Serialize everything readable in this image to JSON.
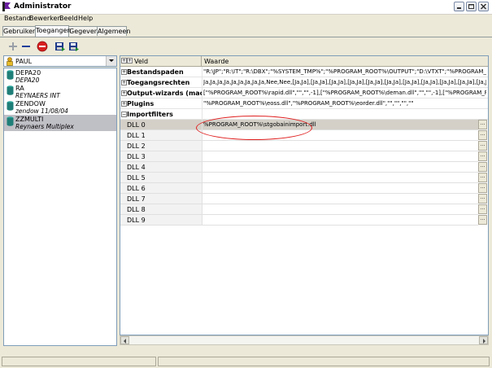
{
  "window": {
    "title": "Administrator"
  },
  "menu": [
    "Bestand",
    "Bewerken",
    "Beeld",
    "Help"
  ],
  "tabs": [
    "Gebruikers",
    "Toegangen",
    "Gegevens",
    "Algemeen"
  ],
  "toolbar": {
    "icons": [
      "add-icon",
      "remove-icon",
      "stop-icon",
      "save-icon",
      "save-as-icon"
    ]
  },
  "user_select": {
    "value": "PAUL"
  },
  "databases": [
    {
      "name": "DEPA20",
      "desc": "DEPA20"
    },
    {
      "name": "RA",
      "desc": "REYNAERS INT"
    },
    {
      "name": "ZENDOW",
      "desc": "zendow 11/08/04"
    },
    {
      "name": "ZZMULTI",
      "desc": "Reynaers Multiplex"
    }
  ],
  "grid": {
    "header": {
      "field": "Veld",
      "value": "Waarde"
    },
    "rows": [
      {
        "name": "Bestandspaden",
        "value": "\"R:\\JP\";\"R:\\IT\";\"R:\\DBX\";\"%SYSTEM_TMP%\";\"%PROGRAM_ROOT%\\OUTPUT\";\"D:\\VTXT\";\"%PROGRAM_ROOT%\\"
      },
      {
        "name": "Toegangsrechten",
        "value": "Ja,Ja,Ja,Ja,Ja,Ja,Ja,Ja,Ja,Nee,Nee,[Ja,Ja],[Ja,Ja],[Ja,Ja],[Ja,Ja],[Ja,Ja],[Ja,Ja],[Ja,Ja],[Ja,Ja],[Ja,Ja],[Ja,Ja],[Ja,Ja],[Ja,Ja],[Ja,Ja]"
      },
      {
        "name": "Output-wizards (machinest",
        "value": "[\"%PROGRAM_ROOT%\\rapid.dll\",\"\",\"\",-1],[\"%PROGRAM_ROOT%\\deman.dll\",\"\",\"\",-1],[\"%PROGRAM_ROOT%\\wegoma"
      },
      {
        "name": "Plugins",
        "value": "\"%PROGRAM_ROOT%\\eoss.dll\",\"%PROGRAM_ROOT%\\eorder.dll\",\"\",\"\",\"\",\"\""
      }
    ],
    "import": {
      "name": "Importfilters",
      "children": [
        {
          "name": "DLL 0",
          "value": "%PROGRAM_ROOT%\\stgobainimport.dll"
        },
        {
          "name": "DLL 1",
          "value": ""
        },
        {
          "name": "DLL 2",
          "value": ""
        },
        {
          "name": "DLL 3",
          "value": ""
        },
        {
          "name": "DLL 4",
          "value": ""
        },
        {
          "name": "DLL 5",
          "value": ""
        },
        {
          "name": "DLL 6",
          "value": ""
        },
        {
          "name": "DLL 7",
          "value": ""
        },
        {
          "name": "DLL 8",
          "value": ""
        },
        {
          "name": "DLL 9",
          "value": ""
        }
      ]
    },
    "edit_button_label": "..."
  },
  "colors": {
    "annotation": "#e02020",
    "selection": "#d4d0c8"
  }
}
